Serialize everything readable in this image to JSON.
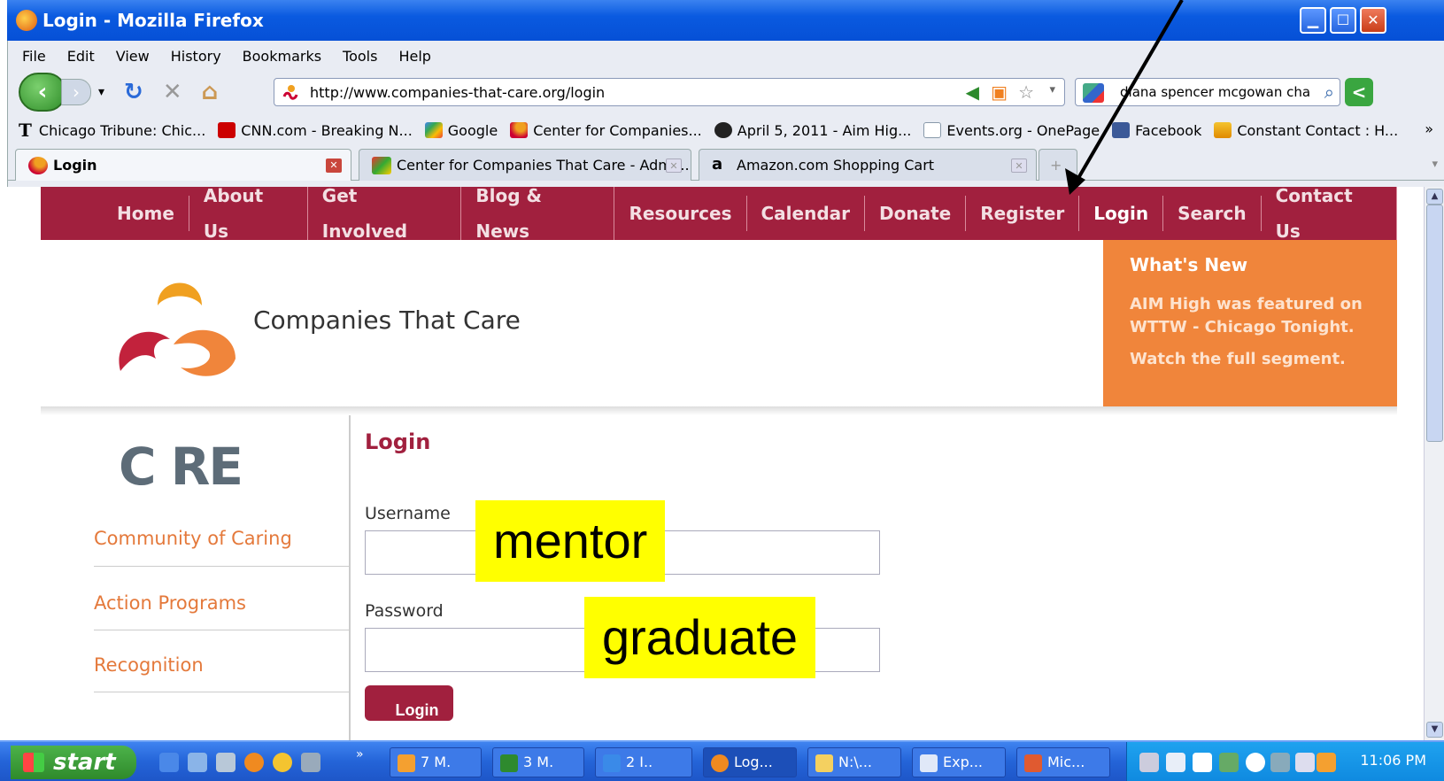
{
  "window": {
    "title": "Login - Mozilla Firefox"
  },
  "menu": [
    "File",
    "Edit",
    "View",
    "History",
    "Bookmarks",
    "Tools",
    "Help"
  ],
  "address": {
    "url": "http://www.companies-that-care.org/login"
  },
  "search": {
    "value": "diana spencer mcgowan cha"
  },
  "bookmarks": [
    "Chicago Tribune: Chic...",
    "CNN.com - Breaking N...",
    "Google",
    "Center for Companies...",
    "April 5, 2011 - Aim Hig...",
    "Events.org - OnePage",
    "Facebook",
    "Constant Contact : H..."
  ],
  "bookmarks_more": "»",
  "tabs": [
    {
      "label": "Login"
    },
    {
      "label": "Center for Companies That Care - Admi..."
    },
    {
      "label": "Amazon.com Shopping Cart"
    }
  ],
  "site": {
    "nav": [
      "Home",
      "About Us",
      "Get Involved",
      "Blog & News",
      "Resources",
      "Calendar",
      "Donate",
      "Register",
      "Login",
      "Search",
      "Contact Us"
    ],
    "brand": "Companies That Care",
    "whats_new": {
      "heading": "What's New",
      "line1": "AIM High was featured on",
      "line2": "WTTW - Chicago Tonight.",
      "line3": "Watch the full segment."
    },
    "sidebar_logo": "C RE",
    "sidebar": [
      "Community of Caring",
      "Action Programs",
      "Recognition"
    ],
    "login": {
      "title": "Login",
      "username_label": "Username",
      "password_label": "Password",
      "button": "Login"
    }
  },
  "annotations": {
    "username_hint": "mentor",
    "password_hint": "graduate"
  },
  "taskbar": {
    "start": "start",
    "items": [
      "7 M.",
      "3 M.",
      "2 I..",
      "Log...",
      "N:\\...",
      "Exp...",
      "Mic..."
    ],
    "clock": "11:06 PM"
  },
  "colors": {
    "brand_red": "#a1203e",
    "brand_orange": "#f0853b",
    "highlight": "#ffff00"
  }
}
